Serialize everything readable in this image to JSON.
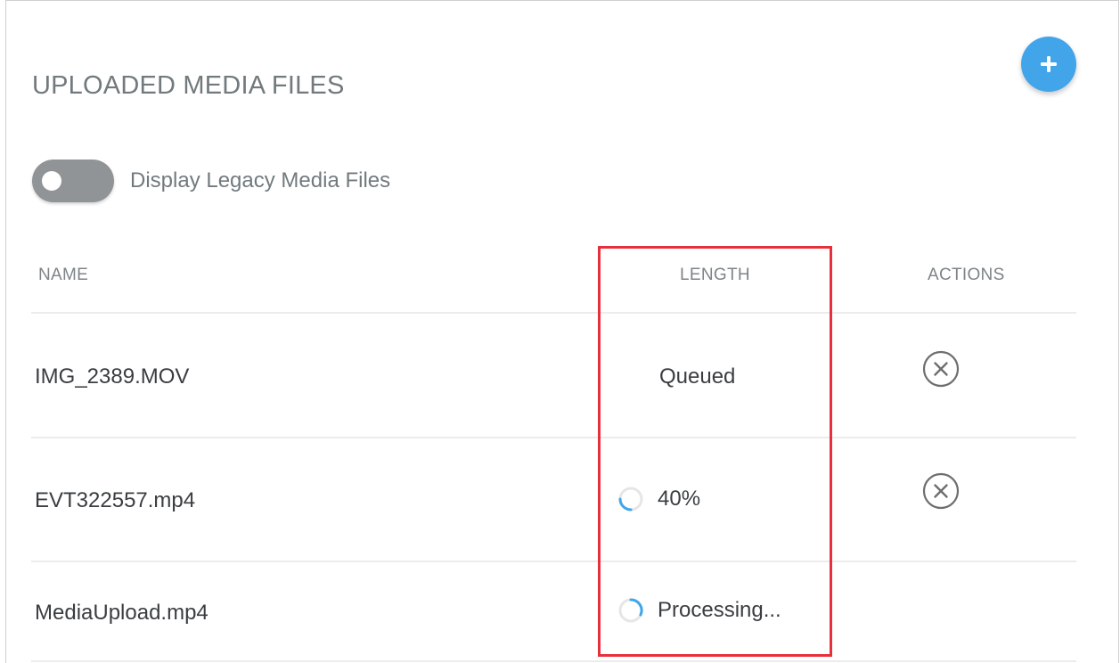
{
  "page": {
    "title": "UPLOADED MEDIA FILES",
    "add_button_symbol": "+"
  },
  "toggle": {
    "label": "Display Legacy Media Files",
    "checked": false
  },
  "table": {
    "headers": {
      "name": "NAME",
      "length": "LENGTH",
      "actions": "ACTIONS"
    },
    "rows": [
      {
        "name": "IMG_2389.MOV",
        "length": "Queued",
        "status": "queued",
        "has_remove_action": true
      },
      {
        "name": "EVT322557.mp4",
        "length": "40%",
        "status": "uploading",
        "progress": 0.4,
        "has_remove_action": true
      },
      {
        "name": "MediaUpload.mp4",
        "length": "Processing...",
        "status": "processing",
        "has_remove_action": false
      }
    ]
  },
  "colors": {
    "accent": "#42a5ea",
    "highlight": "#e8303c",
    "muted_text": "#727a7e",
    "body_text": "#3a3e40",
    "toggle_off": "#909496"
  },
  "icons": {
    "add": "plus-icon",
    "remove": "close-circle-icon",
    "progress": "progress-spinner-icon"
  }
}
